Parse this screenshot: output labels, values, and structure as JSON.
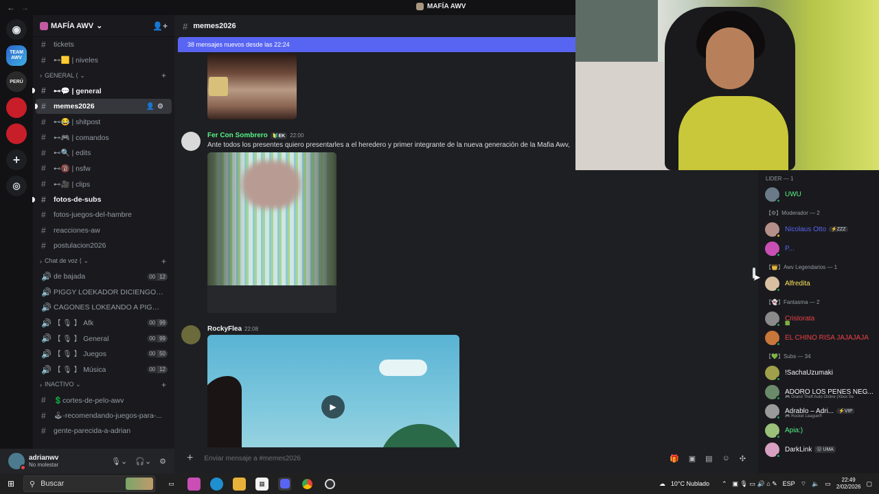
{
  "titlebar": {
    "back": "←",
    "forward": "→",
    "server_title": "MAFÍA AWV"
  },
  "guilds": [
    {
      "name": "discord-home",
      "label": "◉"
    },
    {
      "name": "team-awv",
      "label": "TEAM AWV"
    },
    {
      "name": "peru",
      "label": "PERÚ"
    },
    {
      "name": "server-red-1",
      "label": ""
    },
    {
      "name": "server-red-2",
      "label": ""
    },
    {
      "name": "add-server",
      "label": "+"
    },
    {
      "name": "explore",
      "label": "◎"
    }
  ],
  "server": {
    "name": "MAFÍA AWV",
    "chevron": "⌄"
  },
  "channels": [
    {
      "type": "text",
      "name": "tickets",
      "bold": false
    },
    {
      "type": "text",
      "name": "⊷🟨 | niveles",
      "bold": false
    },
    {
      "type": "category",
      "name": "GENERAL ⟨ ⌄"
    },
    {
      "type": "text",
      "name": "⊷💬 | general",
      "bold": true,
      "unread": true
    },
    {
      "type": "text",
      "name": "memes2026",
      "bold": true,
      "active": true,
      "unread": true
    },
    {
      "type": "text",
      "name": "⊷😂 | shitpost"
    },
    {
      "type": "text",
      "name": "⊷🎮 | comandos"
    },
    {
      "type": "text",
      "name": "⊷🔍 | edits"
    },
    {
      "type": "text",
      "name": "⊷🔞 | nsfw"
    },
    {
      "type": "text",
      "name": "⊷🎥 | clips"
    },
    {
      "type": "text",
      "name": "fotos-de-subs",
      "bold": true,
      "unread": true
    },
    {
      "type": "text",
      "name": "fotos-juegos-del-hambre"
    },
    {
      "type": "text",
      "name": "reacciones-aw"
    },
    {
      "type": "text",
      "name": "postulacion2026"
    },
    {
      "type": "category",
      "name": "Chat de voz ⟨ ⌄"
    },
    {
      "type": "voice",
      "name": "de bajada",
      "badge": [
        "00",
        "12"
      ]
    },
    {
      "type": "voice",
      "name": "PIGGY LOEKADOR DICIENGO G..."
    },
    {
      "type": "voice",
      "name": "CAGONES LOKEANDO A PIGGY ..."
    },
    {
      "type": "voice",
      "name": "【 🎙 】 Afk",
      "badge": [
        "00",
        "99"
      ]
    },
    {
      "type": "voice",
      "name": "【 🎙 】 General",
      "badge": [
        "00",
        "99"
      ]
    },
    {
      "type": "voice",
      "name": "【 🎙 】 Juegos",
      "badge": [
        "00",
        "50"
      ]
    },
    {
      "type": "voice",
      "name": "【 🎙 】 Música",
      "badge": [
        "00",
        "12"
      ]
    },
    {
      "type": "category",
      "name": "INACTIVO ⌄"
    },
    {
      "type": "text",
      "name": "💲cortes-de-pelo-awv"
    },
    {
      "type": "text",
      "name": "🕹-recomendando-juegos-para-..."
    },
    {
      "type": "text",
      "name": "gente-parecida-a-adrian"
    }
  ],
  "user": {
    "name": "adrianwv",
    "status": "No molestar"
  },
  "chat": {
    "channel": "memes2026",
    "new_messages": "38 mensajes nuevos desde las 22:24",
    "messages": [
      {
        "author": "Fer Con Sombrero",
        "tag": "🔰EK",
        "time": "22:00",
        "color": "#57f287",
        "text": "Ante todos los presentes quiero presentarles a el heredero y primer integrante de la nueva generación de la Mafia Awv,"
      },
      {
        "author": "RockyFlea",
        "tag": "",
        "time": "22:08",
        "color": "#f2f3f5",
        "text": ""
      }
    ],
    "composer_placeholder": "Enviar mensaje a #memes2026"
  },
  "members": {
    "groups": [
      {
        "role": "LIDER — 1",
        "members": [
          {
            "name": "UWU",
            "color": "#57f287",
            "status": "#23a55a"
          }
        ]
      },
      {
        "role": "【⚙】Moderador — 2",
        "members": [
          {
            "name": "Nicolaus Otto",
            "color": "#5865f2",
            "badge": "⚡ZZZ",
            "status": "#f0b232"
          },
          {
            "name": "P...",
            "color": "#5865f2",
            "status": "#23a55a"
          }
        ]
      },
      {
        "role": "【👑】Awv Legendarios — 1",
        "members": [
          {
            "name": "Alfredita",
            "color": "#fee75c",
            "status": "#23a55a"
          }
        ]
      },
      {
        "role": "【👻】Fantasma — 2",
        "members": [
          {
            "name": "Cristorata",
            "color": "#ed4245",
            "sub": "🟩",
            "status": "#23a55a"
          },
          {
            "name": "EL CHINO RISA JAJAJAJA",
            "color": "#ed4245",
            "status": "#23a55a"
          }
        ]
      },
      {
        "role": "【💚】Subs — 34",
        "members": [
          {
            "name": "!SachaUzumaki",
            "color": "#f2f3f5",
            "status": "#23a55a"
          },
          {
            "name": "ADORO LOS PENES NEG...",
            "color": "#f2f3f5",
            "sub": "🎮 Grand Theft Auto Online (Xbox Se",
            "status": "#23a55a"
          },
          {
            "name": "Adrablo – Adri...",
            "color": "#f2f3f5",
            "badge": "⚡VIP",
            "sub": "🎮 Rocket League®",
            "status": "#23a55a"
          },
          {
            "name": "Apia:)",
            "color": "#57f287",
            "status": "#23a55a"
          },
          {
            "name": "DarkLink",
            "color": "#f2f3f5",
            "badge": "Ⓤ UMA",
            "status": "#23a55a"
          }
        ]
      }
    ]
  },
  "taskbar": {
    "search": "Buscar",
    "weather": "10°C  Nublado",
    "lang": "ESP",
    "time": "22:49",
    "date": "2/02/2026"
  }
}
